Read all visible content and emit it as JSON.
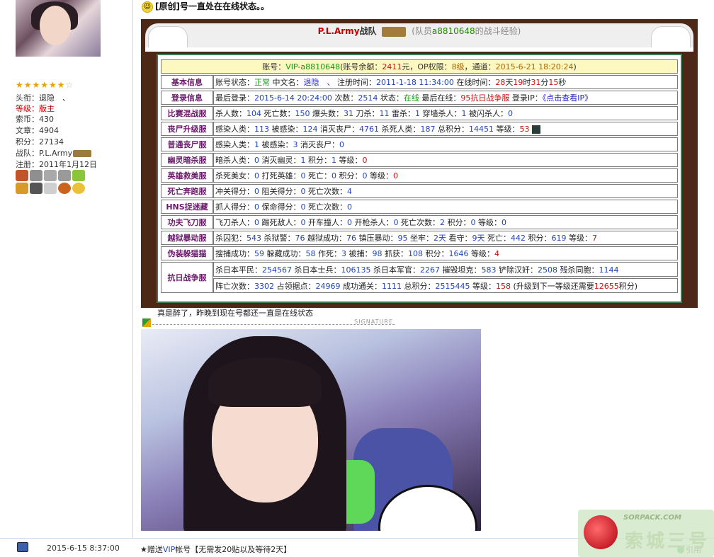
{
  "profile": {
    "stars_filled": "★★★★★★",
    "stars_empty": "☆",
    "title_label": "头衔：",
    "title_value": "退隐　、",
    "level_label": "等级：",
    "level_value": "版主",
    "coins_label": "索币：",
    "coins_value": "430",
    "posts_label": "文章：",
    "posts_value": "4904",
    "points_label": "积分：",
    "points_value": "27134",
    "team_label": "战队：",
    "team_value": "P.L.Army",
    "reg_label": "注册：",
    "reg_value": "2011年1月12日"
  },
  "post": {
    "title": "[原创]号一直处在在线状态。。",
    "under_text": "真是醉了，昨晚到现在号都还一直是在线状态",
    "signature_label": "SIGNATURE"
  },
  "card": {
    "team_name": "P.L.Army",
    "team_suffix": "战队",
    "member_prefix": "(队员",
    "member_name": "a8810648",
    "member_suffix": "的战斗经验)"
  },
  "account": {
    "l1": "账号：",
    "name": "VIP-a8810648",
    "l2": "(账号余额：",
    "balance": "2411",
    "l3": "元，OP权限：",
    "op": "8级",
    "l4": "，通道：",
    "channel": "2015-6-21 18:20:24",
    "l5": ")"
  },
  "rows": {
    "basic": {
      "label": "基本信息",
      "status_label": "账号状态：",
      "status": "正常",
      "cn_label": "中文名：",
      "cn": "退隐　、",
      "reg_label": "注册时间：",
      "reg": "2011-1-18 11:34:00",
      "online_label": "在线时间：",
      "d": "28",
      "d_unit": "天",
      "h": "19",
      "h_unit": "时",
      "m": "31",
      "m_unit": "分",
      "s": "15",
      "s_unit": "秒"
    },
    "login": {
      "label": "登录信息",
      "last_label": "最后登录：",
      "last": "2015-6-14 20:24:00",
      "count_label": "次数：",
      "count": "2514",
      "state_label": "状态：",
      "state": "在线",
      "server_label": "最后在线：",
      "server": "95抗日战争服",
      "ip_label": "登录IP：",
      "ip": "《点击查看IP》"
    },
    "mixed": {
      "label": "比赛混战服",
      "t1": "杀人数：",
      "v1": "104",
      "t2": "死亡数：",
      "v2": "150",
      "t3": "爆头数：",
      "v3": "31",
      "t4": "刀杀：",
      "v4": "11",
      "t5": "雷杀：",
      "v5": "1",
      "t6": "穿墙杀人：",
      "v6": "1",
      "t7": "被闪杀人：",
      "v7": "0"
    },
    "zombie_up": {
      "label": "丧尸升级服",
      "t1": "感染人类：",
      "v1": "113",
      "t2": "被感染：",
      "v2": "124",
      "t3": "消灭丧尸：",
      "v3": "4761",
      "t4": "杀死人类：",
      "v4": "187",
      "t5": "总积分：",
      "v5": "14451",
      "t6": "等级：",
      "v6": "53"
    },
    "zombie": {
      "label": "普通丧尸服",
      "t1": "感染人类：",
      "v1": "1",
      "t2": "被感染：",
      "v2": "3",
      "t3": "消灭丧尸：",
      "v3": "0"
    },
    "ghost": {
      "label": "幽灵暗杀服",
      "t1": "暗杀人类：",
      "v1": "0",
      "t2": "消灭幽灵：",
      "v2": "1",
      "t3": "积分：",
      "v3": "1",
      "t4": "等级：",
      "v4": "0"
    },
    "hero": {
      "label": "英雄救美服",
      "t1": "杀死美女：",
      "v1": "0",
      "t2": "打死英雄：",
      "v2": "0",
      "t3": "死亡：",
      "v3": "0",
      "t4": "积分：",
      "v4": "0",
      "t5": "等级：",
      "v5": "0"
    },
    "death": {
      "label": "死亡奔跑服",
      "t1": "冲关得分：",
      "v1": "0",
      "t2": "阻关得分：",
      "v2": "0",
      "t3": "死亡次数：",
      "v3": "4"
    },
    "hns": {
      "label": "HNS捉迷藏",
      "t1": "抓人得分：",
      "v1": "0",
      "t2": "保命得分：",
      "v2": "0",
      "t3": "死亡次数：",
      "v3": "0"
    },
    "kungfu": {
      "label": "功夫飞刀服",
      "t1": "飞刀杀人：",
      "v1": "0",
      "t2": "踢死敌人：",
      "v2": "0",
      "t3": "开车撞人：",
      "v3": "0",
      "t4": "开枪杀人：",
      "v4": "0",
      "t5": "死亡次数：",
      "v5": "2",
      "t6": "积分：",
      "v6": "0",
      "t7": "等级：",
      "v7": "0"
    },
    "jail": {
      "label": "越狱暴动服",
      "t1": "杀囚犯：",
      "v1": "543",
      "t2": "杀狱警：",
      "v2": "76",
      "t3": "越狱成功：",
      "v3": "76",
      "t4": "镇压暴动：",
      "v4": "95",
      "t5": "坐牢：",
      "v5": "2天",
      "t6": "看守：",
      "v6": "9天",
      "t7": "死亡：",
      "v7": "442",
      "t8": "积分：",
      "v8": "619",
      "t9": "等级：",
      "v9": "7"
    },
    "hide": {
      "label": "伪装躲猫猫",
      "t1": "搜捕成功：",
      "v1": "59",
      "t2": "躲藏成功：",
      "v2": "58",
      "t3": "作死：",
      "v3": "3",
      "t4": "被捕：",
      "v4": "98",
      "t5": "抓获：",
      "v5": "108",
      "t6": "积分：",
      "v6": "1646",
      "t7": "等级：",
      "v7": "4"
    },
    "war": {
      "label": "抗日战争服",
      "t1": "杀日本平民：",
      "v1": "254567",
      "t2": "杀日本士兵：",
      "v2": "106135",
      "t3": "杀日本军官：",
      "v3": "2267",
      "t4": "摧毁坦克：",
      "v4": "583",
      "t5": "铲除汉奸：",
      "v5": "2508",
      "t6": "残杀同胞：",
      "v6": "1144",
      "t7": "阵亡次数：",
      "v7": "3302",
      "t8": "占领据点：",
      "v8": "24969",
      "t9": "成功通关：",
      "v9": "1111",
      "t10": "总积分：",
      "v10": "2515445",
      "t11": "等级：",
      "v11": "158",
      "t12": "(升级到下一等级还需要",
      "v12": "12655",
      "t13": "积分)"
    }
  },
  "bottom": {
    "date": "2015-6-15 8:37:00",
    "promo_prefix": "★赠送",
    "promo_vip": "VIP",
    "promo_rest": "帐号【无需发20贴以及等待2天】",
    "quote": "引用"
  },
  "watermark": {
    "line1": "SORPACK.COM",
    "line2": "索城三号"
  }
}
